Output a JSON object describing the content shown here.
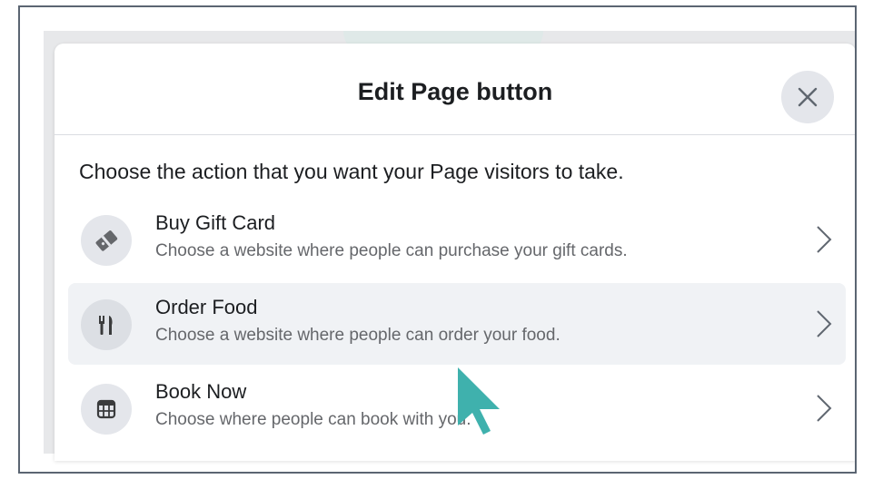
{
  "dialog": {
    "title": "Edit Page button",
    "prompt": "Choose the action that you want your Page visitors to take."
  },
  "options": [
    {
      "title": "Buy Gift Card",
      "subtitle": "Choose a website where people can purchase your gift cards.",
      "icon": "gift-card-icon"
    },
    {
      "title": "Order Food",
      "subtitle": "Choose a website where people can order your food.",
      "icon": "fork-knife-icon"
    },
    {
      "title": "Book Now",
      "subtitle": "Choose where people can book with you.",
      "icon": "calendar-icon"
    }
  ],
  "colors": {
    "cursor": "#3fb1ad",
    "hover_bg": "#f0f2f5",
    "icon_bg": "#e4e6eb"
  }
}
